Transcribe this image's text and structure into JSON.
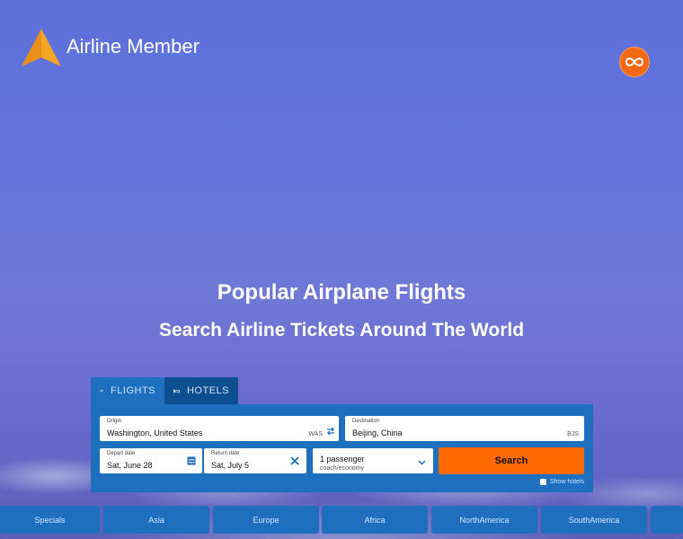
{
  "brand": {
    "name": "Airline Member",
    "accent": "#f5a623"
  },
  "hero": {
    "title": "Popular Airplane Flights",
    "subtitle": "Search Airline Tickets Around The World"
  },
  "tabs": [
    {
      "label": "FLIGHTS",
      "icon": "airplane-icon",
      "active": true
    },
    {
      "label": "HOTELS",
      "icon": "bed-icon",
      "active": false
    }
  ],
  "search": {
    "origin": {
      "label": "Origin",
      "value": "Washington, United States",
      "code": "WAS"
    },
    "destination": {
      "label": "Destination",
      "value": "Beijing, China",
      "code": "BJS"
    },
    "depart": {
      "label": "Depart date",
      "value": "Sat, June 28"
    },
    "return": {
      "label": "Return date",
      "value": "Sat, July 5"
    },
    "passengers": {
      "value": "1 passenger",
      "class": "coach/economy"
    },
    "button": "Search",
    "show_hotels": "Show hotels"
  },
  "regions": [
    "Specials",
    "Asia",
    "Europe",
    "Africa",
    "NorthAmerica",
    "SouthAmerica"
  ],
  "colors": {
    "primary": "#1e6fbd",
    "tab_dark": "#0d4f8f",
    "cta": "#ff6a00"
  }
}
